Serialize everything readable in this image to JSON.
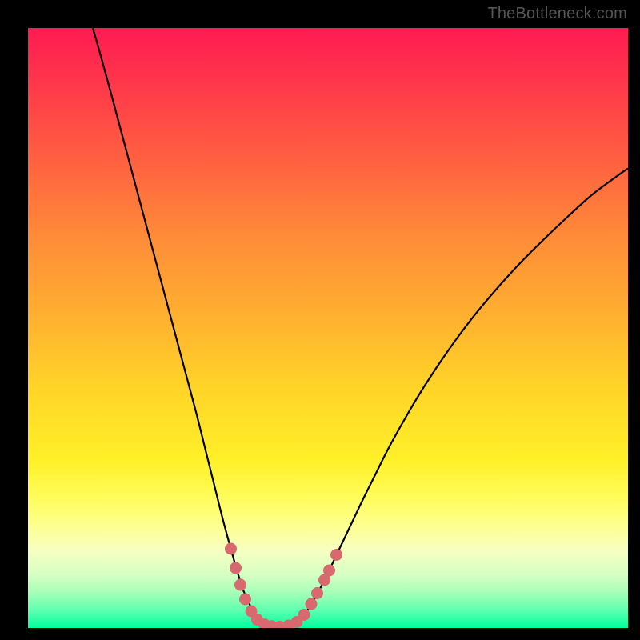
{
  "attribution": "TheBottleneck.com",
  "colors": {
    "background": "#000000",
    "curve_stroke": "#000000",
    "marker_fill": "#d86a6f",
    "marker_stroke": "#d86a6f"
  },
  "chart_data": {
    "type": "line",
    "title": "",
    "xlabel": "",
    "ylabel": "",
    "xlim": [
      0,
      100
    ],
    "ylim": [
      0,
      100
    ],
    "curve_points": [
      {
        "x": 10.8,
        "y": 100.0
      },
      {
        "x": 12.0,
        "y": 95.8
      },
      {
        "x": 14.0,
        "y": 88.5
      },
      {
        "x": 16.0,
        "y": 81.0
      },
      {
        "x": 18.0,
        "y": 73.5
      },
      {
        "x": 20.0,
        "y": 66.0
      },
      {
        "x": 22.0,
        "y": 58.5
      },
      {
        "x": 24.0,
        "y": 51.0
      },
      {
        "x": 26.0,
        "y": 43.5
      },
      {
        "x": 28.0,
        "y": 36.0
      },
      {
        "x": 29.5,
        "y": 30.0
      },
      {
        "x": 31.0,
        "y": 24.0
      },
      {
        "x": 32.5,
        "y": 18.0
      },
      {
        "x": 34.0,
        "y": 12.5
      },
      {
        "x": 35.0,
        "y": 9.0
      },
      {
        "x": 36.0,
        "y": 6.0
      },
      {
        "x": 37.0,
        "y": 3.8
      },
      {
        "x": 38.0,
        "y": 2.0
      },
      {
        "x": 39.0,
        "y": 1.0
      },
      {
        "x": 40.0,
        "y": 0.4
      },
      {
        "x": 41.0,
        "y": 0.2
      },
      {
        "x": 42.0,
        "y": 0.2
      },
      {
        "x": 43.0,
        "y": 0.3
      },
      {
        "x": 44.0,
        "y": 0.6
      },
      {
        "x": 45.0,
        "y": 1.2
      },
      {
        "x": 46.0,
        "y": 2.2
      },
      {
        "x": 47.0,
        "y": 3.6
      },
      {
        "x": 48.0,
        "y": 5.3
      },
      {
        "x": 49.0,
        "y": 7.2
      },
      {
        "x": 50.0,
        "y": 9.2
      },
      {
        "x": 52.0,
        "y": 13.4
      },
      {
        "x": 54.0,
        "y": 17.6
      },
      {
        "x": 56.0,
        "y": 21.8
      },
      {
        "x": 58.0,
        "y": 25.8
      },
      {
        "x": 60.0,
        "y": 29.8
      },
      {
        "x": 63.0,
        "y": 35.2
      },
      {
        "x": 66.0,
        "y": 40.2
      },
      {
        "x": 70.0,
        "y": 46.2
      },
      {
        "x": 74.0,
        "y": 51.6
      },
      {
        "x": 78.0,
        "y": 56.4
      },
      {
        "x": 82.0,
        "y": 60.8
      },
      {
        "x": 86.0,
        "y": 64.8
      },
      {
        "x": 90.0,
        "y": 68.6
      },
      {
        "x": 94.0,
        "y": 72.2
      },
      {
        "x": 98.0,
        "y": 75.2
      },
      {
        "x": 100.0,
        "y": 76.6
      }
    ],
    "markers": [
      {
        "x": 33.8,
        "y": 13.2,
        "r": 7
      },
      {
        "x": 34.6,
        "y": 10.0,
        "r": 7
      },
      {
        "x": 35.4,
        "y": 7.2,
        "r": 7
      },
      {
        "x": 36.2,
        "y": 4.8,
        "r": 7
      },
      {
        "x": 37.2,
        "y": 2.8,
        "r": 7
      },
      {
        "x": 38.2,
        "y": 1.4,
        "r": 7
      },
      {
        "x": 39.4,
        "y": 0.6,
        "r": 7
      },
      {
        "x": 40.6,
        "y": 0.3,
        "r": 7
      },
      {
        "x": 42.0,
        "y": 0.2,
        "r": 7
      },
      {
        "x": 43.4,
        "y": 0.4,
        "r": 7
      },
      {
        "x": 44.8,
        "y": 1.0,
        "r": 7
      },
      {
        "x": 46.0,
        "y": 2.2,
        "r": 7
      },
      {
        "x": 47.2,
        "y": 4.0,
        "r": 7
      },
      {
        "x": 48.2,
        "y": 5.8,
        "r": 7
      },
      {
        "x": 49.4,
        "y": 8.0,
        "r": 7
      },
      {
        "x": 50.2,
        "y": 9.6,
        "r": 7
      },
      {
        "x": 51.4,
        "y": 12.2,
        "r": 7
      }
    ]
  }
}
